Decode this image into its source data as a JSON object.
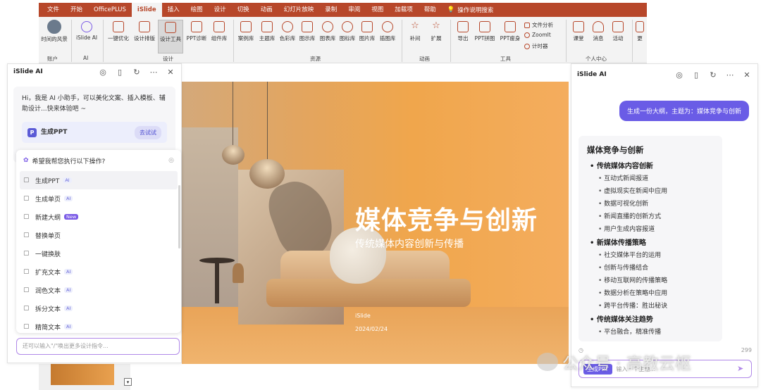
{
  "ribbon": {
    "tabs": [
      "文件",
      "开始",
      "OfficePLUS",
      "iSlide",
      "插入",
      "绘图",
      "设计",
      "切换",
      "动画",
      "幻灯片放映",
      "录制",
      "审阅",
      "视图",
      "加载项",
      "帮助"
    ],
    "active_tab": "iSlide",
    "tell_me": "操作说明搜索",
    "buttons": {
      "account": "时间的风景",
      "islide_ai": "iSlide AI",
      "one_click": "一键优化",
      "design_layout": "设计排版",
      "design_tools": "设计工具",
      "ppt_diag": "PPT诊断",
      "components": "组件库",
      "cases": "案例库",
      "themes": "主题库",
      "colors": "色彩库",
      "icons_lib": "图示库",
      "charts": "图表库",
      "icon_lib": "图标库",
      "pictures": "图片库",
      "illus": "插图库",
      "tween": "补间",
      "expand": "扩展",
      "export": "导出",
      "ppt_merge": "PPT拼图",
      "ppt_slim": "PPT瘦身",
      "file_analysis": "文件分析",
      "zoomit": "ZoomIt",
      "timer": "计时器",
      "classroom": "课堂",
      "messages": "消息",
      "activity": "活动",
      "more": "更"
    },
    "groups": {
      "account": "账户",
      "ai": "AI",
      "design": "设计",
      "resources": "资源",
      "animation": "动画",
      "tools": "工具",
      "personal": "个人中心"
    }
  },
  "left_panel": {
    "title": "iSlide AI",
    "welcome": "Hi，我是 AI 小助手，可以美化文案、插入模板、辅助设计...快来体验吧 ~",
    "gen_label": "生成PPT",
    "try_label": "去试试",
    "menu_prompt": "希望我帮您执行以下操作?",
    "menu": [
      {
        "label": "生成PPT",
        "badge": "AI",
        "icon": "ppt-icon"
      },
      {
        "label": "生成单页",
        "badge": "AI",
        "icon": "page-icon"
      },
      {
        "label": "新建大纲",
        "badge": "New",
        "icon": "outline-icon"
      },
      {
        "label": "替换单页",
        "badge": "",
        "icon": "swap-icon"
      },
      {
        "label": "一键换肤",
        "badge": "",
        "icon": "shirt-icon"
      },
      {
        "label": "扩充文本",
        "badge": "AI",
        "icon": "expand-text-icon"
      },
      {
        "label": "润色文本",
        "badge": "AI",
        "icon": "polish-icon"
      },
      {
        "label": "拆分文本",
        "badge": "AI",
        "icon": "split-icon"
      },
      {
        "label": "精简文本",
        "badge": "AI",
        "icon": "shrink-icon"
      }
    ],
    "input_placeholder": "还可以输入\"/\"唤出更多设计指令..."
  },
  "slide": {
    "title": "媒体竞争与创新",
    "subtitle": "传统媒体内容创新与传播",
    "author": "iSlide",
    "date": "2024/02/24"
  },
  "right_panel": {
    "title": "iSlide AI",
    "user_message": "生成一份大纲，主题为：媒体竞争与创新",
    "outline": {
      "title": "媒体竞争与创新",
      "sections": [
        {
          "heading": "传统媒体内容创新",
          "items": [
            "互动式新闻报道",
            "虚拟现实在新闻中应用",
            "数据可视化创新",
            "新闻直播的创新方式",
            "用户生成内容报道"
          ]
        },
        {
          "heading": "新媒体传播策略",
          "items": [
            "社交媒体平台的运用",
            "创新与传播结合",
            "移动互联网的传播策略",
            "数据分析在策略中应用",
            "跨平台传播：胜出秘诀"
          ]
        },
        {
          "heading": "传统媒体关注趋势",
          "items": [
            "平台融合，精准传播"
          ]
        }
      ]
    },
    "char_count": "299",
    "input_tag": "生成PPT",
    "input_placeholder": "输入一个主题..."
  },
  "watermark": "公众号 · 高教云枢"
}
